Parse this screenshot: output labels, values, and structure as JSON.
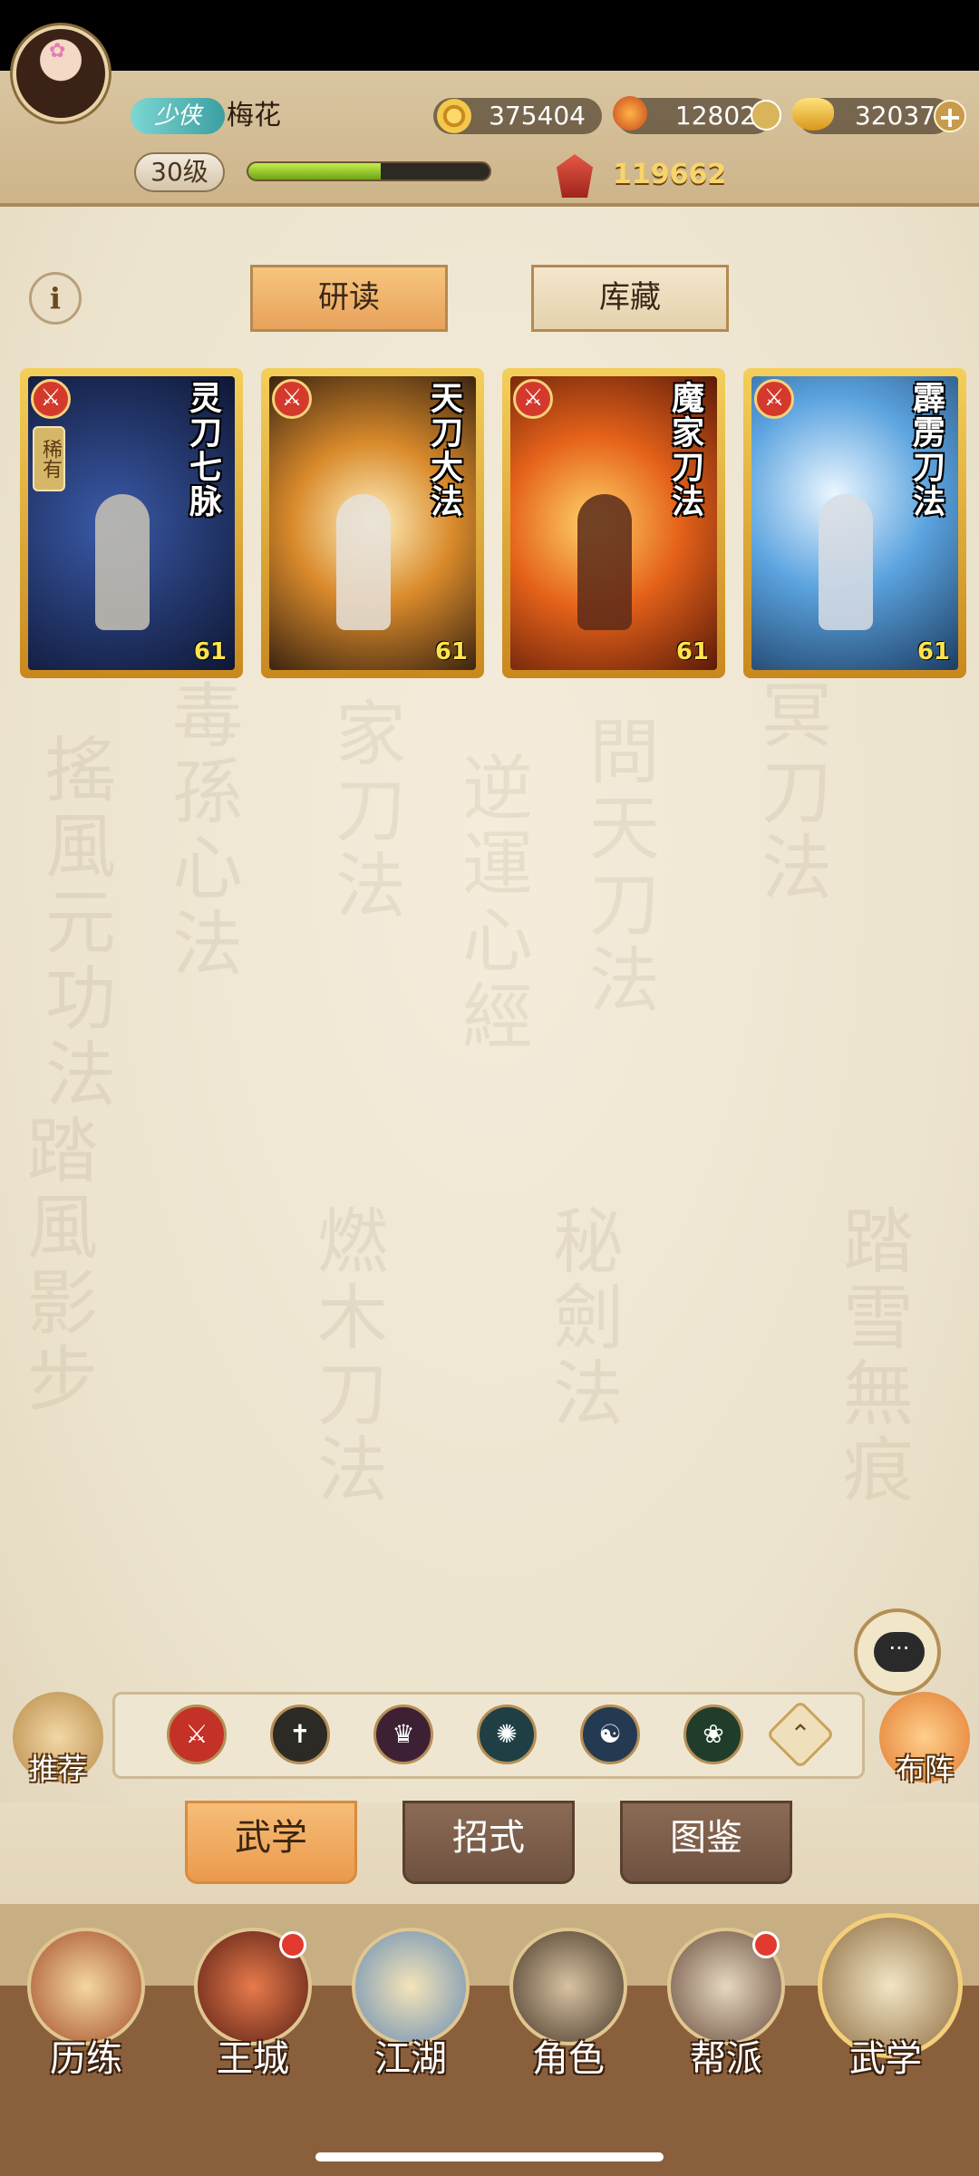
{
  "player": {
    "title_tag": "少侠",
    "name": "梅花",
    "level": "30级",
    "xp_fraction": 0.55,
    "power": "119662"
  },
  "resources": {
    "copper": "375404",
    "flame": "12802",
    "gold": "32037"
  },
  "tabs": {
    "study": "研读",
    "storage": "库藏"
  },
  "info_label": "i",
  "cards": [
    {
      "name": "灵刀七脉",
      "level": "61",
      "rare": "稀有",
      "palette": "#1c2b5a"
    },
    {
      "name": "天刀大法",
      "level": "61",
      "rare": "",
      "palette": "#7a4a1e"
    },
    {
      "name": "魔家刀法",
      "level": "61",
      "rare": "",
      "palette": "#a24a12"
    },
    {
      "name": "霹雳刀法",
      "level": "61",
      "rare": "",
      "palette": "#2d6ea3"
    }
  ],
  "side_buttons": {
    "recommend": "推荐",
    "formation": "布阵"
  },
  "filters": [
    {
      "name": "red-filter",
      "color": "#c43127"
    },
    {
      "name": "dark-filter",
      "color": "#2b2a25"
    },
    {
      "name": "purple-filter",
      "color": "#3e2035"
    },
    {
      "name": "teal-filter",
      "color": "#1f3f45"
    },
    {
      "name": "blue-filter",
      "color": "#243a52"
    },
    {
      "name": "green-filter",
      "color": "#1f3d2a"
    }
  ],
  "section_tabs": {
    "martial": "武学",
    "moves": "招式",
    "catalog": "图鉴"
  },
  "nav": [
    {
      "label": "历练",
      "badge": false
    },
    {
      "label": "王城",
      "badge": true
    },
    {
      "label": "江湖",
      "badge": false
    },
    {
      "label": "角色",
      "badge": false
    },
    {
      "label": "帮派",
      "badge": true
    },
    {
      "label": "武学",
      "badge": false
    }
  ]
}
